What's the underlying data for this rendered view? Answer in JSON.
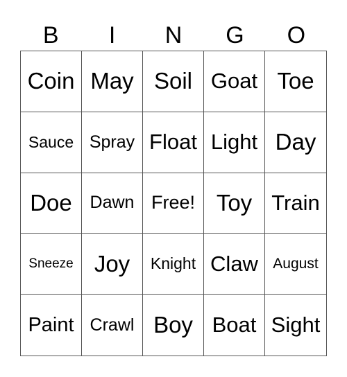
{
  "card": {
    "header": [
      "B",
      "I",
      "N",
      "G",
      "O"
    ],
    "rows": [
      [
        "Coin",
        "May",
        "Soil",
        "Goat",
        "Toe"
      ],
      [
        "Sauce",
        "Spray",
        "Float",
        "Light",
        "Day"
      ],
      [
        "Doe",
        "Dawn",
        "Free!",
        "Toy",
        "Train"
      ],
      [
        "Sneeze",
        "Joy",
        "Knight",
        "Claw",
        "August"
      ],
      [
        "Paint",
        "Crawl",
        "Boy",
        "Boat",
        "Sight"
      ]
    ]
  }
}
